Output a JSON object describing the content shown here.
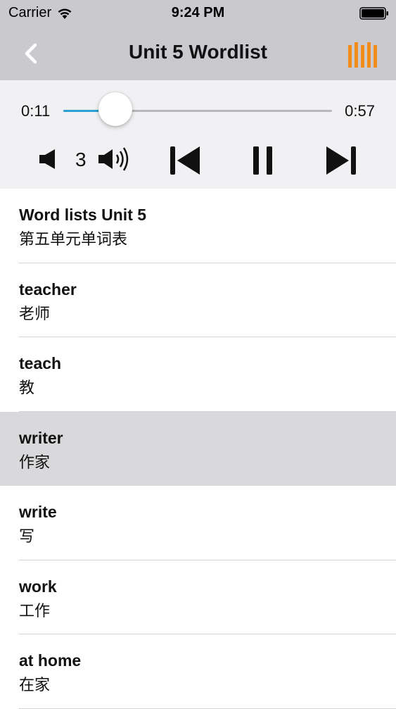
{
  "status_bar": {
    "carrier": "Carrier",
    "time": "9:24 PM"
  },
  "nav": {
    "title": "Unit 5 Wordlist",
    "back_icon": "chevron-left-icon",
    "menu_icon": "bars-icon",
    "accent_color": "#f28c18"
  },
  "player": {
    "elapsed": "0:11",
    "total": "0:57",
    "progress": 0.193,
    "volume": "3",
    "accent_color": "#2aa0d6"
  },
  "words": [
    {
      "en": "Word lists Unit 5",
      "zh": "第五单元单词表",
      "selected": false
    },
    {
      "en": "teacher",
      "zh": "老师",
      "selected": false
    },
    {
      "en": "teach",
      "zh": "教",
      "selected": false
    },
    {
      "en": "writer",
      "zh": "作家",
      "selected": true
    },
    {
      "en": "write",
      "zh": "写",
      "selected": false
    },
    {
      "en": "work",
      "zh": "工作",
      "selected": false
    },
    {
      "en": "at home",
      "zh": "在家",
      "selected": false
    }
  ]
}
